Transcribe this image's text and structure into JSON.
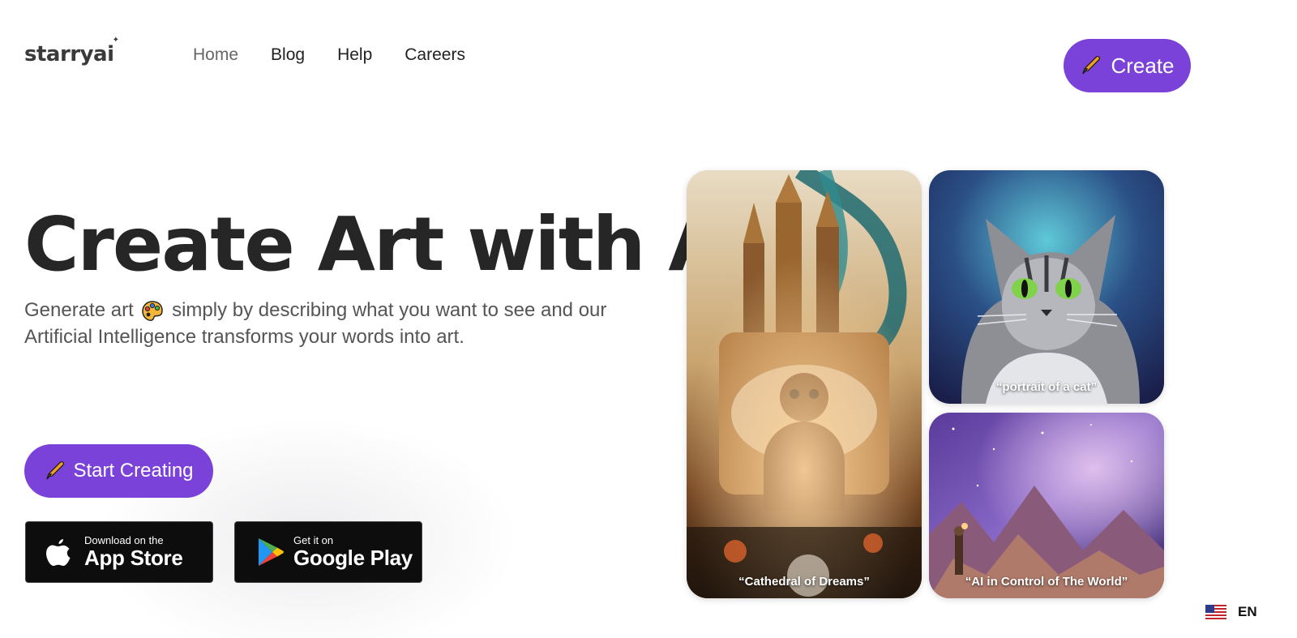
{
  "brand": {
    "logo": "starryai",
    "accent": "#7a42d8"
  },
  "nav": {
    "items": [
      "Home",
      "Blog",
      "Help",
      "Careers"
    ]
  },
  "header": {
    "create_label": "Create"
  },
  "hero": {
    "title": "Create Art with AI",
    "subtitle_before": "Generate art",
    "subtitle_after": "simply by describing what you want to see and our Artificial Intelligence transforms your words into art.",
    "start_label": "Start Creating"
  },
  "stores": {
    "apple": {
      "small": "Download on the",
      "big": "App Store"
    },
    "google": {
      "small": "Get it on",
      "big": "Google Play"
    }
  },
  "gallery": [
    {
      "caption": "“Cathedral of Dreams”"
    },
    {
      "caption": "“portrait of a cat”"
    },
    {
      "caption": "“AI in Control of The World”"
    }
  ],
  "language": {
    "code": "EN",
    "icon": "us-flag-icon"
  }
}
